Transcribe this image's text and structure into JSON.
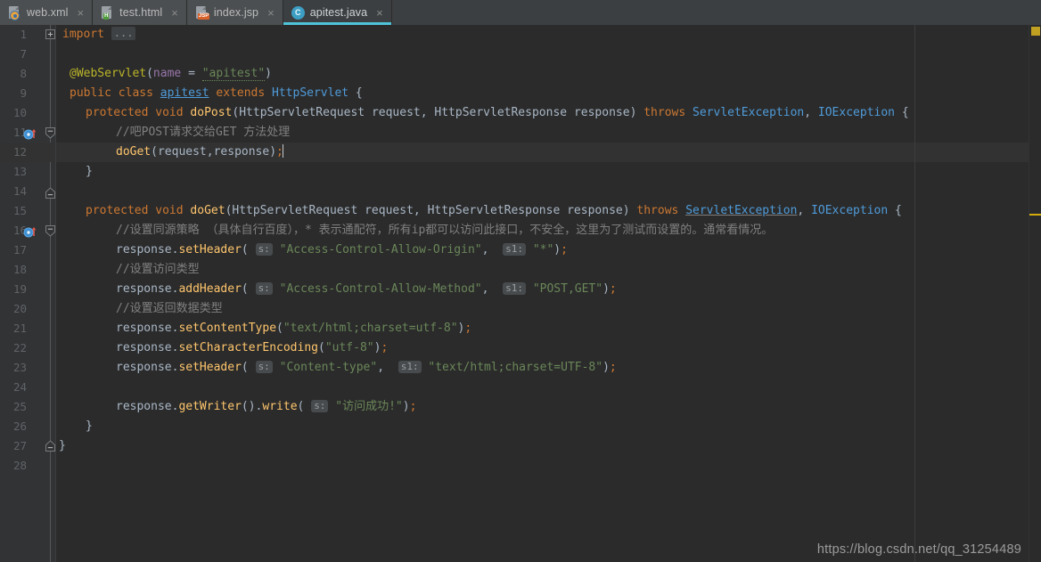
{
  "window": {
    "theme_bg": "#2b2b2b",
    "gutter_bg": "#313335",
    "accent": "#4fc3d9"
  },
  "tabs": [
    {
      "label": "web.xml",
      "icon": "xml-file-icon",
      "badge": "",
      "active": false,
      "close_glyph": "×"
    },
    {
      "label": "test.html",
      "icon": "html-file-icon",
      "badge": "H",
      "active": false,
      "close_glyph": "×"
    },
    {
      "label": "index.jsp",
      "icon": "jsp-file-icon",
      "badge": "JSP",
      "active": false,
      "close_glyph": "×"
    },
    {
      "label": "apitest.java",
      "icon": "java-file-icon",
      "badge": "C",
      "active": true,
      "close_glyph": "×"
    }
  ],
  "editor": {
    "current_line": 12,
    "line_numbers": [
      1,
      7,
      8,
      9,
      10,
      11,
      12,
      13,
      14,
      15,
      16,
      17,
      18,
      19,
      20,
      21,
      22,
      23,
      24,
      25,
      26,
      27,
      28
    ],
    "fold_collapsed_glyph": "+",
    "ellipsis": "...",
    "lines": {
      "1": "import ...",
      "7": "",
      "8": "@WebServlet(name = \"apitest\")",
      "9": "public class apitest extends HttpServlet {",
      "10": "protected void doPost(HttpServletRequest request, HttpServletResponse response) throws ServletException, IOException {",
      "11": "//吧POST请求交给GET 方法处理",
      "12": "doGet(request,response);",
      "13": "}",
      "14": "",
      "15": "protected void doGet(HttpServletRequest request, HttpServletResponse response) throws ServletException, IOException {",
      "16": "//设置同源策略 （具体自行百度），* 表示通配符，所有ip都可以访问此接口，不安全，这里为了测试而设置的。通常看情况。",
      "17": "response.setHeader( s: \"Access-Control-Allow-Origin\",  s1: \"*\");",
      "18": "//设置访问类型",
      "19": "response.addHeader( s: \"Access-Control-Allow-Method\",  s1: \"POST,GET\");",
      "20": "//设置返回数据类型",
      "21": "response.setContentType(\"text/html;charset=utf-8\");",
      "22": "response.setCharacterEncoding(\"utf-8\");",
      "23": "response.setHeader( s: \"Content-type\",  s1: \"text/html;charset=UTF-8\");",
      "24": "",
      "25": "response.getWriter().write( s: \"访问成功!\");",
      "26": "}",
      "27": "}",
      "28": ""
    },
    "tokens": {
      "kw_import": "import",
      "kw_public": "public",
      "kw_class": "class",
      "kw_extends": "extends",
      "kw_protected": "protected",
      "kw_void": "void",
      "kw_throws": "throws",
      "anno_webservlet": "@WebServlet",
      "name_param": "name",
      "eq": "=",
      "str_apitest": "\"apitest\"",
      "cls_apitest": "apitest",
      "cls_httpservlet": "HttpServlet",
      "cls_req": "HttpServletRequest",
      "cls_res": "HttpServletResponse",
      "var_request": "request",
      "var_response": "response",
      "ex_servlet": "ServletException",
      "ex_io": "IOException",
      "m_doPost": "doPost",
      "m_doGet": "doGet",
      "m_setHeader": "setHeader",
      "m_addHeader": "addHeader",
      "m_setContentType": "setContentType",
      "m_setCharacterEncoding": "setCharacterEncoding",
      "m_getWriter": "getWriter",
      "m_write": "write",
      "hint_s": "s:",
      "hint_s1": "s1:",
      "str_origin": "\"Access-Control-Allow-Origin\"",
      "str_star": "\"*\"",
      "str_method_hdr": "\"Access-Control-Allow-Method\"",
      "str_postget": "\"POST,GET\"",
      "str_texthtml_utf8": "\"text/html;charset=utf-8\"",
      "str_utf8": "\"utf-8\"",
      "str_contenttype": "\"Content-type\"",
      "str_texthtml_UTF8": "\"text/html;charset=UTF-8\"",
      "str_success": "\"访问成功!\"",
      "cmt_11": "//吧POST请求交给GET 方法处理",
      "cmt_16": "//设置同源策略 （具体自行百度），* 表示通配符，所有ip都可以访问此接口，不安全，这里为了测试而设置的。通常看情况。",
      "cmt_18": "//设置访问类型",
      "cmt_20": "//设置返回数据类型"
    }
  },
  "markers": {
    "warning_square_color": "#bfa021",
    "stripe_color": "#d4ac0d"
  },
  "watermark": {
    "text": "https://blog.csdn.net/qq_31254489"
  }
}
